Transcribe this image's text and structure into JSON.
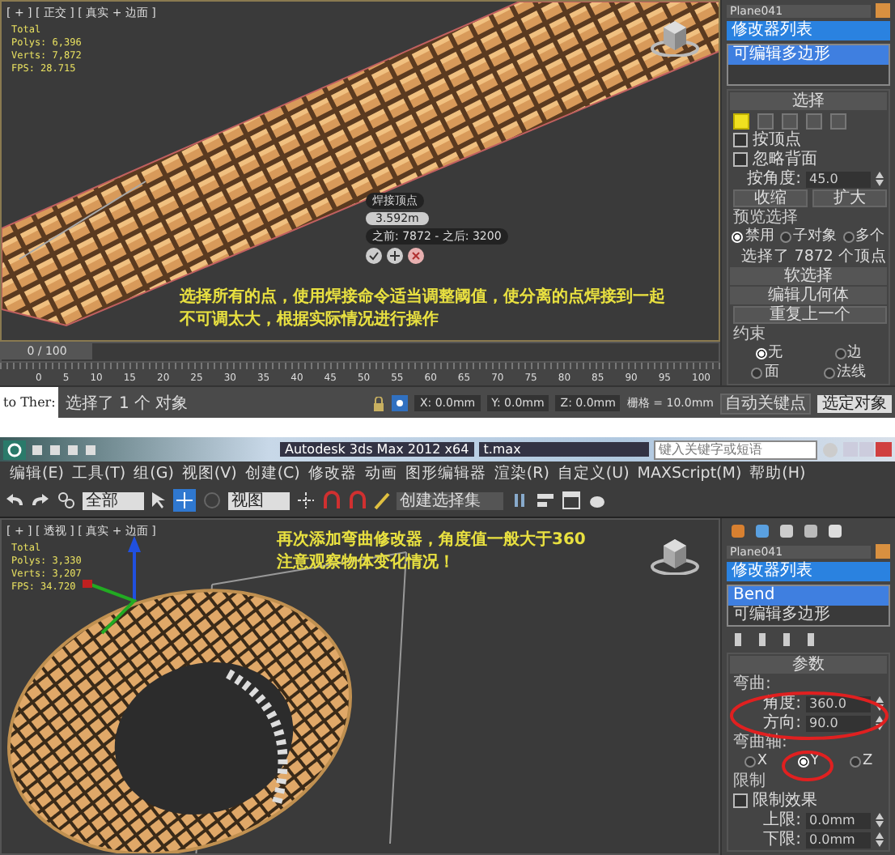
{
  "top_window": {
    "viewport": {
      "label": "[ + ] [ 正交 ] [ 真实 + 边面 ]",
      "stats": [
        "Total",
        "Polys: 6,396",
        "Verts: 7,872",
        "FPS: 28.715"
      ],
      "weld_caddy": {
        "title": "焊接顶点",
        "value": "3.592m",
        "info": "之前: 7872 - 之后: 3200"
      },
      "caption": [
        "选择所有的点，使用焊接命令适当调整阈值，使分离的点焊接到一起",
        "不可调太大，根据实际情况进行操作"
      ]
    },
    "timeline": {
      "position": "0 / 100",
      "level": 0,
      "ticks": [
        "0",
        "5",
        "10",
        "15",
        "20",
        "25",
        "30",
        "35",
        "40",
        "45",
        "50",
        "55",
        "60",
        "65",
        "70",
        "75",
        "80",
        "85",
        "90",
        "95",
        "100"
      ]
    },
    "command_panel": {
      "object_name": "Plane041",
      "modifier_list": "修改器列表",
      "stack": [
        {
          "label": "可编辑多边形",
          "selected": true
        }
      ],
      "rows": [
        {
          "kind": "header",
          "label": "选择"
        },
        {
          "kind": "subobjects",
          "items": [
            {
              "selected": true
            },
            {
              "selected": false
            },
            {
              "selected": false
            },
            {
              "selected": false
            },
            {
              "selected": false
            }
          ]
        },
        {
          "kind": "checkbox",
          "label": "按顶点",
          "checked": false
        },
        {
          "kind": "checkbox",
          "label": "忽略背面",
          "checked": false
        },
        {
          "kind": "spinner",
          "label": "按角度:",
          "value": "45.0"
        },
        {
          "kind": "buttons",
          "labels": [
            "收缩",
            "扩大"
          ]
        },
        {
          "kind": "group",
          "label": "预览选择"
        },
        {
          "kind": "radios",
          "options": [
            {
              "label": "禁用",
              "selected": true
            },
            {
              "label": "子对象",
              "selected": false
            },
            {
              "label": "多个",
              "selected": false
            }
          ]
        },
        {
          "kind": "text",
          "label": "选择了 7872 个顶点"
        },
        {
          "kind": "header",
          "label": "软选择"
        },
        {
          "kind": "header",
          "label": "编辑几何体"
        },
        {
          "kind": "buttons",
          "labels": [
            "重复上一个"
          ]
        },
        {
          "kind": "group",
          "label": "约束"
        },
        {
          "kind": "radios",
          "options": [
            {
              "label": "无",
              "selected": true
            },
            {
              "label": "边",
              "selected": false
            }
          ]
        },
        {
          "kind": "radios",
          "options": [
            {
              "label": "面",
              "selected": false
            },
            {
              "label": "法线",
              "selected": false
            }
          ]
        }
      ]
    },
    "status_bar": {
      "side_text": "to Ther:",
      "prompt": "选择了 1 个 对象",
      "coords": [
        "X: 0.0mm",
        "Y: 0.0mm",
        "Z: 0.0mm"
      ],
      "grid": "栅格 = 10.0mm",
      "auto_key": "自动关键点",
      "key_mode": "选定对象"
    }
  },
  "bottom_window": {
    "title_bar": {
      "title": "Autodesk 3ds Max  2012 x64",
      "file": "t.max",
      "search_placeholder": "键入关键字或短语"
    },
    "menu": [
      "编辑(E)",
      "工具(T)",
      "组(G)",
      "视图(V)",
      "创建(C)",
      "修改器",
      "动画",
      "图形编辑器",
      "渲染(R)",
      "自定义(U)",
      "MAXScript(M)",
      "帮助(H)"
    ],
    "toolbar": {
      "selection_filter": "全部",
      "reference_coord": "视图",
      "named_selection": "创建选择集"
    },
    "viewport": {
      "label": "[ + ] [ 透视 ] [ 真实 + 边面 ]",
      "stats": [
        "Total",
        "Polys: 3,330",
        "Verts: 3,207",
        "FPS: 34.720"
      ],
      "caption": [
        "再次添加弯曲修改器，角度值一般大于360",
        "注意观察物体变化情况！"
      ]
    },
    "command_panel": {
      "object_name": "Plane041",
      "modifier_list": "修改器列表",
      "stack": [
        {
          "label": "Bend",
          "selected": true
        },
        {
          "label": "可编辑多边形",
          "selected": false
        }
      ],
      "rows": [
        {
          "kind": "header",
          "label": "参数"
        },
        {
          "kind": "group",
          "label": "弯曲:"
        },
        {
          "kind": "spinner",
          "label": "角度:",
          "value": "360.0"
        },
        {
          "kind": "spinner",
          "label": "方向:",
          "value": "90.0"
        },
        {
          "kind": "group",
          "label": "弯曲轴:"
        },
        {
          "kind": "radios",
          "options": [
            {
              "label": "X",
              "selected": false
            },
            {
              "label": "Y",
              "selected": true
            },
            {
              "label": "Z",
              "selected": false
            }
          ]
        },
        {
          "kind": "group",
          "label": "限制"
        },
        {
          "kind": "checkbox",
          "label": "限制效果",
          "checked": false
        },
        {
          "kind": "spinner",
          "label": "上限:",
          "value": "0.0mm"
        },
        {
          "kind": "spinner",
          "label": "下限:",
          "value": "0.0mm"
        }
      ]
    }
  }
}
